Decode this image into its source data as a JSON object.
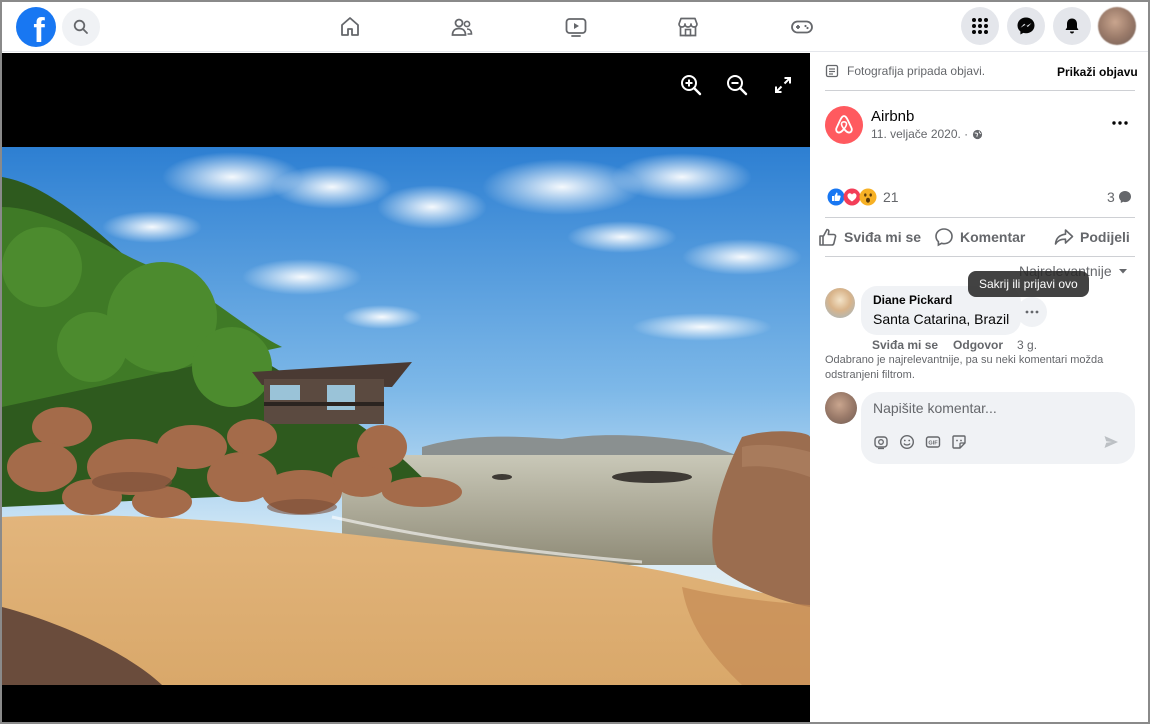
{
  "nav": {
    "logo_letter": "f",
    "icons": [
      "home-icon",
      "friends-icon",
      "watch-icon",
      "marketplace-icon",
      "gaming-icon"
    ],
    "right_icons": [
      "menu-grid-icon",
      "messenger-icon",
      "notifications-icon"
    ]
  },
  "photo": {
    "tools": [
      "zoom-in-icon",
      "zoom-out-icon",
      "fullscreen-icon"
    ]
  },
  "panel": {
    "notice_text": "Fotografija pripada objavi.",
    "show_post_label": "Prikaži objavu",
    "page_name": "Airbnb",
    "post_date": "11. veljače 2020. ·",
    "brand_color": "#ff5a5f",
    "reactions_count": "21",
    "comments_count": "3",
    "actions": {
      "like": "Sviđa mi se",
      "comment": "Komentar",
      "share": "Podijeli"
    },
    "sort_label": "Najrelevantnije",
    "tooltip": "Sakrij ili prijavi ovo",
    "comment": {
      "author": "Diane Pickard",
      "text": "Santa Catarina, Brazil",
      "like_label": "Sviđa mi se",
      "reply_label": "Odgovor",
      "age": "3 g."
    },
    "filter_note": "Odabrano je najrelevantnije, pa su neki komentari možda odstranjeni filtrom.",
    "write_placeholder": "Napišite komentar...",
    "composer_tools": [
      "sticker-camera-icon",
      "emoji-icon",
      "gif-icon",
      "sticker-icon",
      "send-icon"
    ]
  },
  "colors": {
    "fb_blue": "#1877f2",
    "secondary_text": "#65676b"
  }
}
